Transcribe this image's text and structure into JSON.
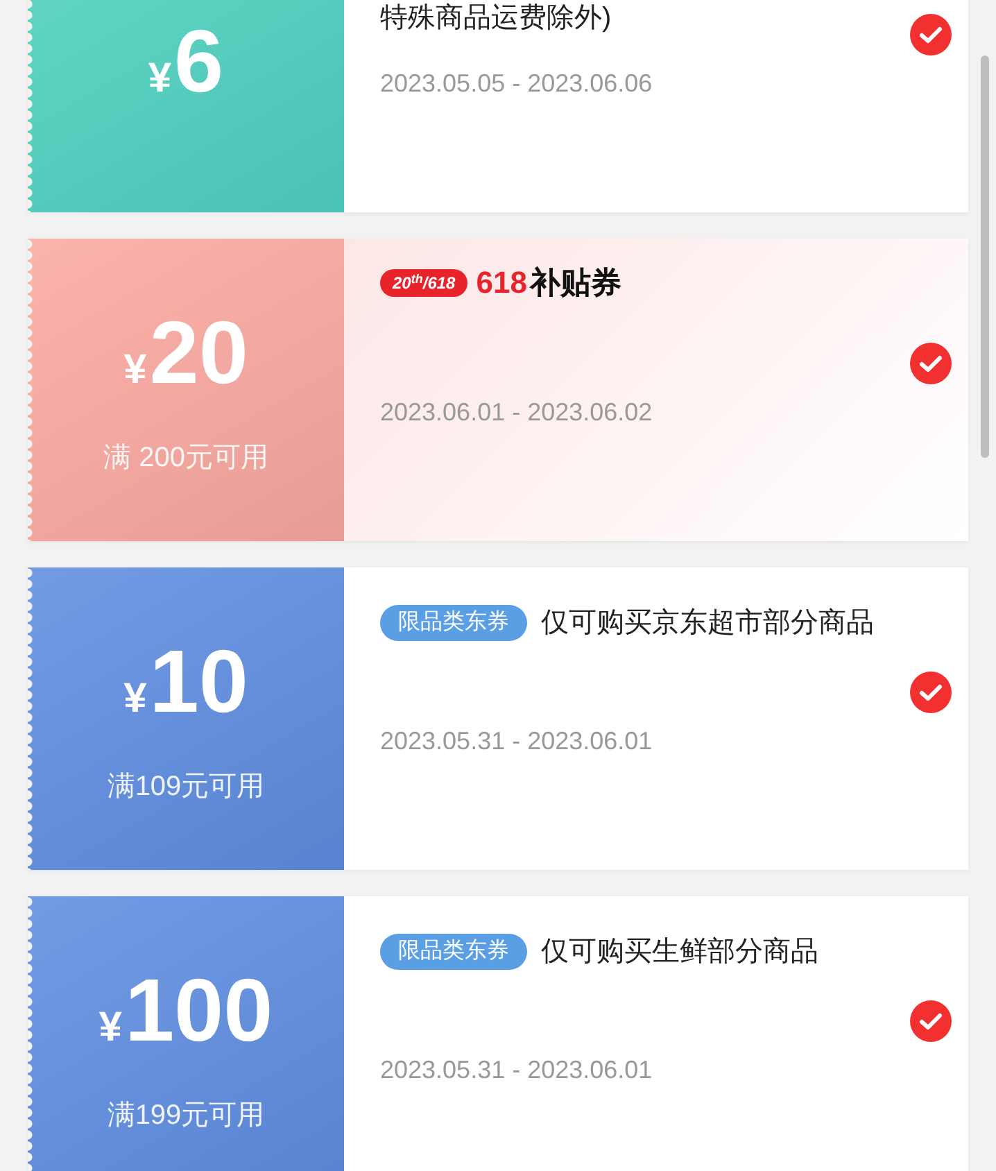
{
  "coupons": [
    {
      "kind": "shipping",
      "color": "#4fd3c0",
      "currency": "¥",
      "amount": "6",
      "description": "特殊商品运费除外)",
      "date": "2023.05.05 - 2023.06.06",
      "checked": true
    },
    {
      "kind": "promo",
      "color": "#fca9a0",
      "currency": "¥",
      "amount": "20",
      "condition": "满 200元可用",
      "badge": "20$^{th}$/618",
      "title_number": "618",
      "title": "补贴券",
      "date": "2023.06.01 - 2023.06.02",
      "checked": true
    },
    {
      "kind": "category",
      "color": "#5f8ee0",
      "currency": "¥",
      "amount": "10",
      "condition": "满109元可用",
      "tag": "限品类东券",
      "description": "仅可购买京东超市部分商品",
      "date": "2023.05.31 - 2023.06.01",
      "checked": true
    },
    {
      "kind": "category",
      "color": "#5f8ee0",
      "currency": "¥",
      "amount": "100",
      "condition": "满199元可用",
      "tag": "限品类东券",
      "description": "仅可购买生鲜部分商品",
      "date": "2023.05.31 - 2023.06.01",
      "checked": true
    }
  ]
}
